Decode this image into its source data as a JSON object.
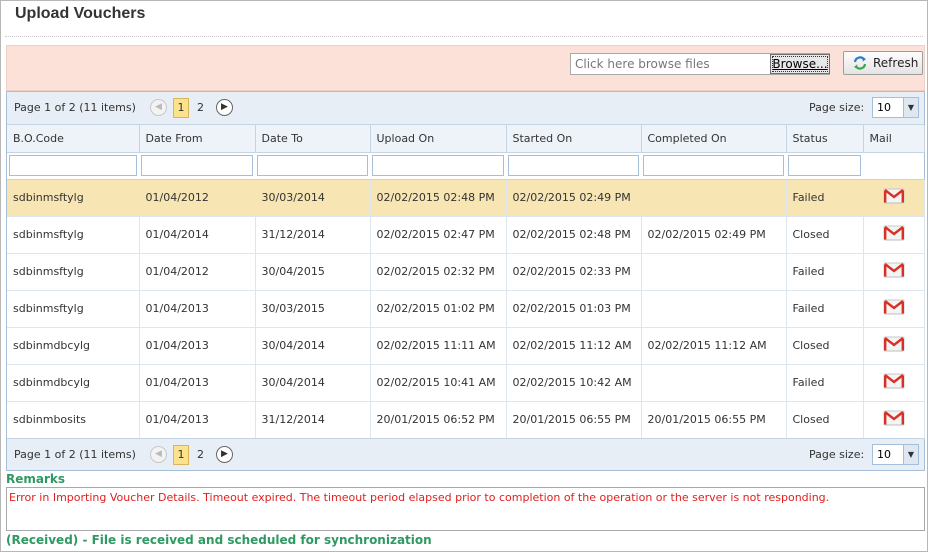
{
  "page": {
    "title": "Upload Vouchers"
  },
  "toolbar": {
    "file_placeholder": "Click here browse files",
    "browse_label": "Browse...",
    "refresh_label": "Refresh"
  },
  "pager": {
    "info": "Page 1 of 2 (11 items)",
    "prev_icon": "chevron-left-icon",
    "next_icon": "chevron-right-icon",
    "pages": [
      "1",
      "2"
    ],
    "current_page": "1",
    "page_size_label": "Page size:",
    "page_size_value": "10"
  },
  "table": {
    "columns": [
      "B.O.Code",
      "Date From",
      "Date To",
      "Upload On",
      "Started On",
      "Completed On",
      "Status",
      "Mail"
    ],
    "rows": [
      {
        "code": "sdbinmsftylg",
        "from": "01/04/2012",
        "to": "30/03/2014",
        "upload": "02/02/2015 02:48 PM",
        "started": "02/02/2015 02:49 PM",
        "completed": "",
        "status": "Failed"
      },
      {
        "code": "sdbinmsftylg",
        "from": "01/04/2014",
        "to": "31/12/2014",
        "upload": "02/02/2015 02:47 PM",
        "started": "02/02/2015 02:48 PM",
        "completed": "02/02/2015 02:49 PM",
        "status": "Closed"
      },
      {
        "code": "sdbinmsftylg",
        "from": "01/04/2012",
        "to": "30/04/2015",
        "upload": "02/02/2015 02:32 PM",
        "started": "02/02/2015 02:33 PM",
        "completed": "",
        "status": "Failed"
      },
      {
        "code": "sdbinmsftylg",
        "from": "01/04/2013",
        "to": "30/03/2015",
        "upload": "02/02/2015 01:02 PM",
        "started": "02/02/2015 01:03 PM",
        "completed": "",
        "status": "Failed"
      },
      {
        "code": "sdbinmdbcylg",
        "from": "01/04/2013",
        "to": "30/04/2014",
        "upload": "02/02/2015 11:11 AM",
        "started": "02/02/2015 11:12 AM",
        "completed": "02/02/2015 11:12 AM",
        "status": "Closed"
      },
      {
        "code": "sdbinmdbcylg",
        "from": "01/04/2013",
        "to": "30/04/2014",
        "upload": "02/02/2015 10:41 AM",
        "started": "02/02/2015 10:42 AM",
        "completed": "",
        "status": "Failed"
      },
      {
        "code": "sdbinmbosits",
        "from": "01/04/2013",
        "to": "31/12/2014",
        "upload": "20/01/2015 06:52 PM",
        "started": "20/01/2015 06:55 PM",
        "completed": "20/01/2015 06:55 PM",
        "status": "Closed"
      }
    ],
    "mail_icon": "gmail-icon",
    "selected_row": 0
  },
  "remarks": {
    "title": "Remarks",
    "text": "Error in Importing Voucher Details. Timeout expired.  The timeout period elapsed prior to completion of the operation or the server is not responding."
  },
  "legend": {
    "text": "(Received) - File is received and scheduled for synchronization"
  },
  "colors": {
    "toolbar_bg": "#fce1d9",
    "selected_row": "#f7e5b3",
    "error_text": "#e0201f",
    "legend_text": "#2e9a62",
    "pager_bg": "#e7eef6"
  }
}
